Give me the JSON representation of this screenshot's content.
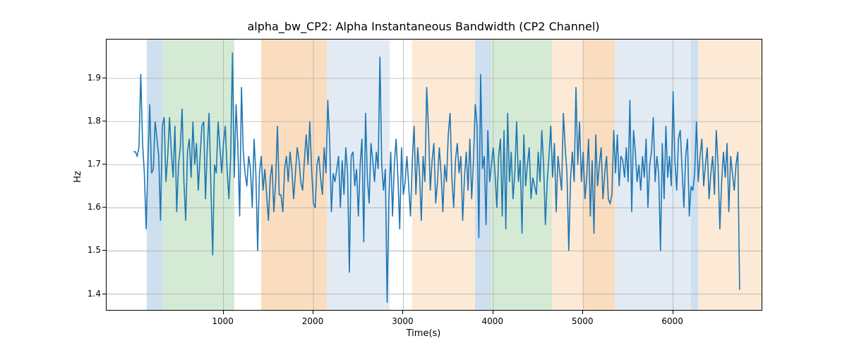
{
  "chart_data": {
    "type": "line",
    "title": "alpha_bw_CP2: Alpha Instantaneous Bandwidth (CP2 Channel)",
    "xlabel": "Time(s)",
    "ylabel": "Hz",
    "xlim": [
      -300,
      7000
    ],
    "ylim": [
      1.36,
      1.99
    ],
    "xticks": [
      1000,
      2000,
      3000,
      4000,
      5000,
      6000
    ],
    "yticks": [
      1.4,
      1.5,
      1.6,
      1.7,
      1.8,
      1.9
    ],
    "bands": [
      {
        "x0": 150,
        "x1": 320,
        "color": "#c5d9ec",
        "alpha": 0.85
      },
      {
        "x0": 320,
        "x1": 1120,
        "color": "#cee6ce",
        "alpha": 0.85
      },
      {
        "x0": 1420,
        "x1": 2150,
        "color": "#f9d7b4",
        "alpha": 0.85
      },
      {
        "x0": 2150,
        "x1": 2850,
        "color": "#dde7f2",
        "alpha": 0.85
      },
      {
        "x0": 3100,
        "x1": 3800,
        "color": "#fce6cf",
        "alpha": 0.85
      },
      {
        "x0": 3800,
        "x1": 3970,
        "color": "#c5d9ec",
        "alpha": 0.85
      },
      {
        "x0": 3970,
        "x1": 4650,
        "color": "#cee6ce",
        "alpha": 0.85
      },
      {
        "x0": 4650,
        "x1": 5000,
        "color": "#fce6cf",
        "alpha": 0.85
      },
      {
        "x0": 5000,
        "x1": 5350,
        "color": "#f9d7b4",
        "alpha": 0.85
      },
      {
        "x0": 5350,
        "x1": 6200,
        "color": "#dde7f2",
        "alpha": 0.85
      },
      {
        "x0": 6200,
        "x1": 6280,
        "color": "#c5d9ec",
        "alpha": 0.85
      },
      {
        "x0": 6280,
        "x1": 7000,
        "color": "#fce6cf",
        "alpha": 0.85
      }
    ],
    "series": [
      {
        "name": "alpha_bw_CP2",
        "color": "#1f77b4",
        "x_start": 0,
        "x_step": 20,
        "y": [
          1.73,
          1.73,
          1.72,
          1.74,
          1.91,
          1.75,
          1.68,
          1.55,
          1.71,
          1.84,
          1.68,
          1.69,
          1.8,
          1.76,
          1.72,
          1.57,
          1.79,
          1.81,
          1.66,
          1.72,
          1.81,
          1.73,
          1.67,
          1.79,
          1.59,
          1.7,
          1.74,
          1.83,
          1.66,
          1.57,
          1.73,
          1.76,
          1.67,
          1.8,
          1.7,
          1.75,
          1.64,
          1.72,
          1.79,
          1.8,
          1.62,
          1.74,
          1.82,
          1.65,
          1.49,
          1.7,
          1.68,
          1.8,
          1.74,
          1.68,
          1.75,
          1.79,
          1.69,
          1.62,
          1.72,
          1.96,
          1.67,
          1.84,
          1.74,
          1.58,
          1.88,
          1.73,
          1.68,
          1.65,
          1.72,
          1.69,
          1.6,
          1.76,
          1.68,
          1.5,
          1.68,
          1.72,
          1.64,
          1.69,
          1.63,
          1.57,
          1.67,
          1.7,
          1.59,
          1.66,
          1.79,
          1.63,
          1.63,
          1.59,
          1.69,
          1.72,
          1.66,
          1.73,
          1.69,
          1.62,
          1.68,
          1.74,
          1.71,
          1.66,
          1.64,
          1.71,
          1.77,
          1.7,
          1.8,
          1.69,
          1.61,
          1.6,
          1.7,
          1.72,
          1.67,
          1.63,
          1.74,
          1.68,
          1.85,
          1.76,
          1.59,
          1.68,
          1.66,
          1.69,
          1.72,
          1.6,
          1.71,
          1.63,
          1.74,
          1.68,
          1.45,
          1.72,
          1.73,
          1.65,
          1.69,
          1.58,
          1.7,
          1.76,
          1.52,
          1.82,
          1.67,
          1.61,
          1.75,
          1.71,
          1.66,
          1.73,
          1.69,
          1.95,
          1.7,
          1.64,
          1.69,
          1.38,
          1.62,
          1.73,
          1.58,
          1.7,
          1.76,
          1.67,
          1.55,
          1.74,
          1.63,
          1.66,
          1.72,
          1.65,
          1.58,
          1.71,
          1.79,
          1.63,
          1.74,
          1.68,
          1.57,
          1.72,
          1.66,
          1.88,
          1.78,
          1.64,
          1.71,
          1.75,
          1.61,
          1.66,
          1.74,
          1.68,
          1.59,
          1.7,
          1.66,
          1.77,
          1.82,
          1.67,
          1.6,
          1.71,
          1.75,
          1.68,
          1.72,
          1.57,
          1.67,
          1.73,
          1.64,
          1.76,
          1.62,
          1.71,
          1.84,
          1.79,
          1.53,
          1.91,
          1.69,
          1.72,
          1.56,
          1.78,
          1.66,
          1.7,
          1.74,
          1.68,
          1.6,
          1.72,
          1.76,
          1.58,
          1.78,
          1.55,
          1.82,
          1.66,
          1.73,
          1.62,
          1.68,
          1.8,
          1.66,
          1.71,
          1.54,
          1.77,
          1.65,
          1.7,
          1.74,
          1.62,
          1.67,
          1.65,
          1.63,
          1.73,
          1.66,
          1.78,
          1.7,
          1.56,
          1.66,
          1.72,
          1.79,
          1.67,
          1.75,
          1.59,
          1.72,
          1.68,
          1.64,
          1.82,
          1.74,
          1.68,
          1.5,
          1.67,
          1.73,
          1.66,
          1.88,
          1.7,
          1.8,
          1.66,
          1.73,
          1.62,
          1.67,
          1.76,
          1.58,
          1.71,
          1.54,
          1.77,
          1.65,
          1.7,
          1.74,
          1.62,
          1.68,
          1.72,
          1.62,
          1.61,
          1.63,
          1.78,
          1.68,
          1.77,
          1.65,
          1.72,
          1.71,
          1.67,
          1.74,
          1.66,
          1.85,
          1.59,
          1.78,
          1.73,
          1.66,
          1.7,
          1.64,
          1.72,
          1.67,
          1.76,
          1.6,
          1.7,
          1.73,
          1.81,
          1.66,
          1.72,
          1.68,
          1.5,
          1.75,
          1.62,
          1.79,
          1.67,
          1.72,
          1.65,
          1.87,
          1.71,
          1.64,
          1.76,
          1.78,
          1.69,
          1.6,
          1.72,
          1.76,
          1.58,
          1.65,
          1.64,
          1.68,
          1.8,
          1.66,
          1.72,
          1.76,
          1.65,
          1.7,
          1.74,
          1.62,
          1.68,
          1.72,
          1.63,
          1.78,
          1.7,
          1.55,
          1.66,
          1.73,
          1.67,
          1.75,
          1.59,
          1.72,
          1.68,
          1.64,
          1.7,
          1.73,
          1.41
        ]
      }
    ]
  }
}
